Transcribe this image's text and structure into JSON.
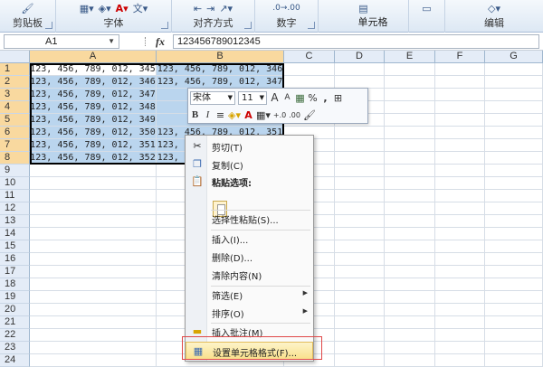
{
  "ribbon": {
    "groups": [
      {
        "label": "剪贴板"
      },
      {
        "label": "字体"
      },
      {
        "label": "对齐方式"
      },
      {
        "label": "数字"
      },
      {
        "label": "单元格"
      },
      {
        "label": "编辑"
      }
    ]
  },
  "formula_bar": {
    "name_box": "A1",
    "fx": "fx",
    "content": "123456789012345"
  },
  "sheet": {
    "columns": [
      "A",
      "B",
      "C",
      "D",
      "E",
      "F",
      "G"
    ],
    "rows": [
      "1",
      "2",
      "3",
      "4",
      "5",
      "6",
      "7",
      "8",
      "9",
      "10",
      "11",
      "12",
      "13",
      "14",
      "15",
      "16",
      "17",
      "18",
      "19",
      "20",
      "21",
      "22",
      "23",
      "24"
    ],
    "col_a": [
      "123, 456, 789, 012, 345",
      "123, 456, 789, 012, 346",
      "123, 456, 789, 012, 347",
      "123, 456, 789, 012, 348",
      "123, 456, 789, 012, 349",
      "123, 456, 789, 012, 350",
      "123, 456, 789, 012, 351",
      "123, 456, 789, 012, 352"
    ],
    "col_b": [
      "123, 456, 789, 012, 346",
      "123, 456, 789, 012, 347",
      "123",
      "123",
      "123",
      "123, 456, 789, 012, 351",
      "123, 456, 789, 012, 352",
      "123, 456, 789, 012, 353"
    ]
  },
  "mini_toolbar": {
    "font": "宋体",
    "size": "11",
    "grow_label": "A",
    "shrink_label": "A",
    "percent": "%",
    "comma": ",",
    "bold": "B",
    "italic": "I",
    "font_color_letter": "A",
    "inc_decimal": ".00→.0",
    "dec_decimal": ".00"
  },
  "context_menu": {
    "items": [
      {
        "label": "剪切(T)",
        "icon": "scissors-icon"
      },
      {
        "label": "复制(C)",
        "icon": "copy-icon"
      },
      {
        "label": "粘贴选项:",
        "icon": "paste-icon"
      },
      {
        "label": "选择性粘贴(S)...",
        "icon": ""
      },
      {
        "label": "插入(I)...",
        "icon": ""
      },
      {
        "label": "删除(D)...",
        "icon": ""
      },
      {
        "label": "清除内容(N)",
        "icon": ""
      },
      {
        "label": "筛选(E)",
        "icon": ""
      },
      {
        "label": "排序(O)",
        "icon": ""
      },
      {
        "label": "插入批注(M)",
        "icon": "comment-icon"
      },
      {
        "label": "设置单元格格式(F)...",
        "icon": "format-cells-icon"
      }
    ]
  },
  "colors": {
    "selection": "#bad5ee",
    "header_selected": "#f9d99f",
    "highlight_box": "#e04848"
  }
}
